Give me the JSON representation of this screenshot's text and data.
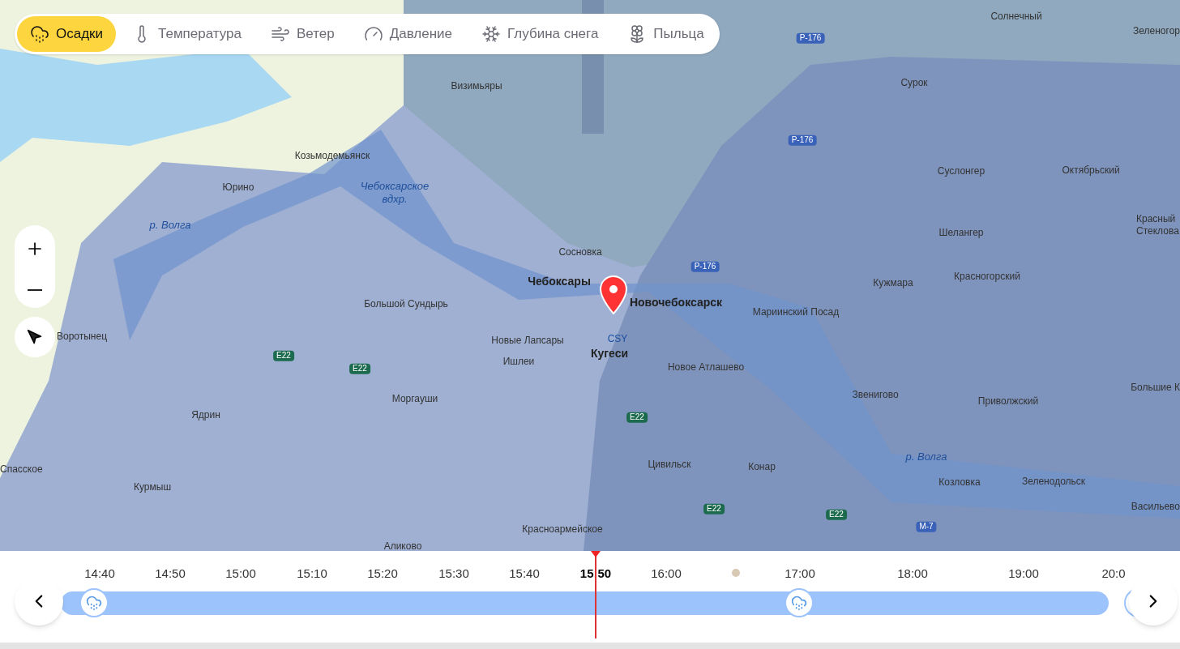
{
  "layers": [
    {
      "label": "Осадки",
      "selected": true
    },
    {
      "label": "Температура",
      "selected": false
    },
    {
      "label": "Ветер",
      "selected": false
    },
    {
      "label": "Давление",
      "selected": false
    },
    {
      "label": "Глубина снега",
      "selected": false
    },
    {
      "label": "Пыльца",
      "selected": false
    }
  ],
  "map_labels": [
    {
      "text": "Солнечный",
      "kind": "town"
    },
    {
      "text": "Зеленогор",
      "kind": "town"
    },
    {
      "text": "Р-176",
      "kind": "road"
    },
    {
      "text": "Визимьяры",
      "kind": "town"
    },
    {
      "text": "Сурок",
      "kind": "town"
    },
    {
      "text": "Р-176",
      "kind": "road"
    },
    {
      "text": "Козьмодемьянск",
      "kind": "town"
    },
    {
      "text": "Суслонгер",
      "kind": "town"
    },
    {
      "text": "Октябрьский",
      "kind": "town"
    },
    {
      "text": "Юрино",
      "kind": "town"
    },
    {
      "text": "Чебоксарское вдхр.",
      "kind": "water"
    },
    {
      "text": "р. Волга",
      "kind": "water"
    },
    {
      "text": "Шелангер",
      "kind": "town"
    },
    {
      "text": "Красный Стеклова",
      "kind": "town"
    },
    {
      "text": "Сосновка",
      "kind": "town"
    },
    {
      "text": "Р-176",
      "kind": "road"
    },
    {
      "text": "Чебоксары",
      "kind": "city"
    },
    {
      "text": "Кужмара",
      "kind": "town"
    },
    {
      "text": "Красногорский",
      "kind": "town"
    },
    {
      "text": "Большой Сундырь",
      "kind": "town"
    },
    {
      "text": "Новочебоксарск",
      "kind": "city"
    },
    {
      "text": "Мариинский Посад",
      "kind": "town"
    },
    {
      "text": "Воротынец",
      "kind": "town"
    },
    {
      "text": "Новые Лапсары",
      "kind": "town"
    },
    {
      "text": "CSY",
      "kind": "airport"
    },
    {
      "text": "E22",
      "kind": "route"
    },
    {
      "text": "E22",
      "kind": "route"
    },
    {
      "text": "Ишлеи",
      "kind": "town"
    },
    {
      "text": "Кугеси",
      "kind": "city"
    },
    {
      "text": "Новое Атлашево",
      "kind": "town"
    },
    {
      "text": "Моргауши",
      "kind": "town"
    },
    {
      "text": "Звенигово",
      "kind": "town"
    },
    {
      "text": "Приволжский",
      "kind": "town"
    },
    {
      "text": "Большие К",
      "kind": "town"
    },
    {
      "text": "Ядрин",
      "kind": "town"
    },
    {
      "text": "E22",
      "kind": "route"
    },
    {
      "text": "Спасское",
      "kind": "town"
    },
    {
      "text": "Цивильск",
      "kind": "town"
    },
    {
      "text": "Конар",
      "kind": "town"
    },
    {
      "text": "р. Волга",
      "kind": "water"
    },
    {
      "text": "Курмыш",
      "kind": "town"
    },
    {
      "text": "Козловка",
      "kind": "town"
    },
    {
      "text": "Зеленодольск",
      "kind": "town"
    },
    {
      "text": "E22",
      "kind": "route"
    },
    {
      "text": "E22",
      "kind": "route"
    },
    {
      "text": "Васильево",
      "kind": "town"
    },
    {
      "text": "Красноармейское",
      "kind": "town"
    },
    {
      "text": "М-7",
      "kind": "road"
    },
    {
      "text": "Аликово",
      "kind": "town"
    }
  ],
  "timeline": [
    {
      "label": "14:40",
      "selected": false
    },
    {
      "label": "14:50",
      "selected": false
    },
    {
      "label": "15:00",
      "selected": false
    },
    {
      "label": "15:10",
      "selected": false
    },
    {
      "label": "15:20",
      "selected": false
    },
    {
      "label": "15:30",
      "selected": false
    },
    {
      "label": "15:40",
      "selected": false
    },
    {
      "label": "15:50",
      "selected": true
    },
    {
      "label": "16:00",
      "selected": false
    },
    {
      "label": "17:00",
      "selected": false
    },
    {
      "label": "18:00",
      "selected": false
    },
    {
      "label": "19:00",
      "selected": false
    },
    {
      "label": "20:0",
      "selected": false
    }
  ]
}
